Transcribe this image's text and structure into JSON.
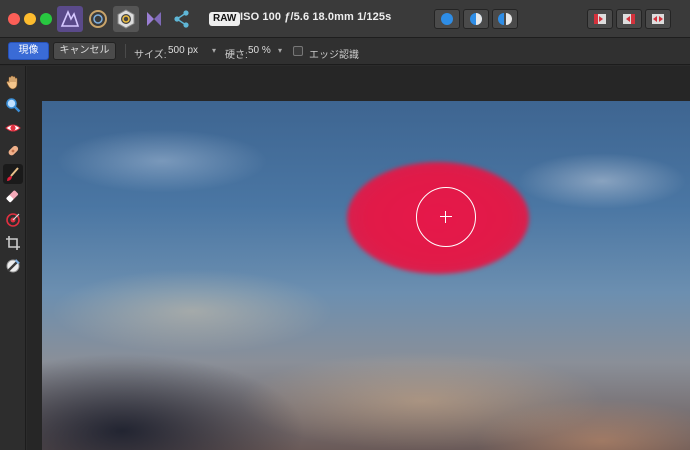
{
  "window": {
    "exif_text": "ISO 100 ƒ/5.6 18.0mm 1/125s",
    "raw_label": "RAW"
  },
  "context_toolbar": {
    "apply_label": "現像",
    "cancel_label": "キャンセル",
    "size_label": "サイズ:",
    "size_value": "500 px",
    "hardness_label": "硬さ:",
    "hardness_value": "50 %",
    "edge_detect_label": "エッジ認識"
  },
  "colors": {
    "accent": "#3a6bd6",
    "selection_overlay": "#e11a48"
  },
  "personas": [
    "photo-persona-icon",
    "liquify-persona-icon",
    "develop-persona-icon",
    "tone-mapping-persona-icon",
    "export-persona-icon"
  ],
  "tools": [
    "hand-icon",
    "zoom-icon",
    "red-eye-icon",
    "blemish-icon",
    "overlay-brush-icon",
    "overlay-eraser-icon",
    "overlay-gradient-icon",
    "crop-icon",
    "white-balance-icon"
  ]
}
